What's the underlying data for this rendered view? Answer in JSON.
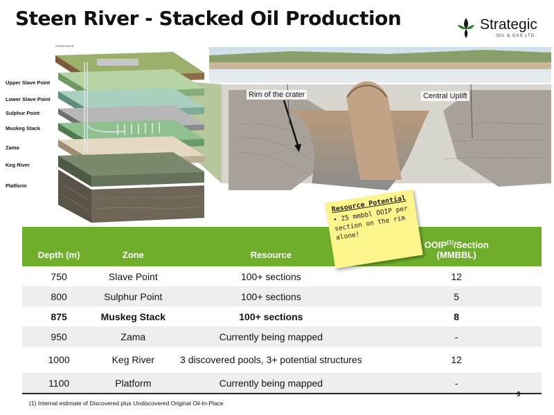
{
  "title": "Steen River - Stacked Oil Production",
  "logo": {
    "name": "Strategic",
    "sub": "OIL & GAS LTD."
  },
  "diagram": {
    "top_label": "STEEN RIVER",
    "layers": [
      "Upper Slave Point",
      "Lower Slave Point",
      "Sulphur Point",
      "Muskeg Stack",
      "Zama",
      "Keg River",
      "Platform"
    ],
    "callouts": {
      "rim": "Rim of the crater",
      "uplift": "Central Uplift"
    }
  },
  "note": {
    "title": "Resource Potential",
    "body": "25 mmbbl OOIP per section on the rim alone!"
  },
  "table": {
    "headers": {
      "depth": "Depth (m)",
      "zone": "Zone",
      "resource": "Resource",
      "ooip_pre": "OOIP",
      "ooip_sup": "(1)",
      "ooip_post": "/Section",
      "ooip_line2": "(MMBBL)"
    },
    "rows": [
      {
        "depth": "750",
        "zone": "Slave Point",
        "resource": "100+ sections",
        "ooip": "12"
      },
      {
        "depth": "800",
        "zone": "Sulphur Point",
        "resource": "100+ sections",
        "ooip": "5"
      },
      {
        "depth": "875",
        "zone": "Muskeg Stack",
        "resource": "100+ sections",
        "ooip": "8"
      },
      {
        "depth": "950",
        "zone": "Zama",
        "resource": "Currently being mapped",
        "ooip": "-"
      },
      {
        "depth": "1000",
        "zone": "Keg River",
        "resource": "3 discovered pools, 3+ potential structures",
        "ooip": "12"
      },
      {
        "depth": "1100",
        "zone": "Platform",
        "resource": "Currently being mapped",
        "ooip": "-"
      }
    ]
  },
  "footnote": "(1) Internal estimate of Discovered plus Undiscovered Original Oil-In-Place",
  "page_number": "9",
  "colors": {
    "table_header": "#6fae2b",
    "note": "#fbf58c"
  }
}
